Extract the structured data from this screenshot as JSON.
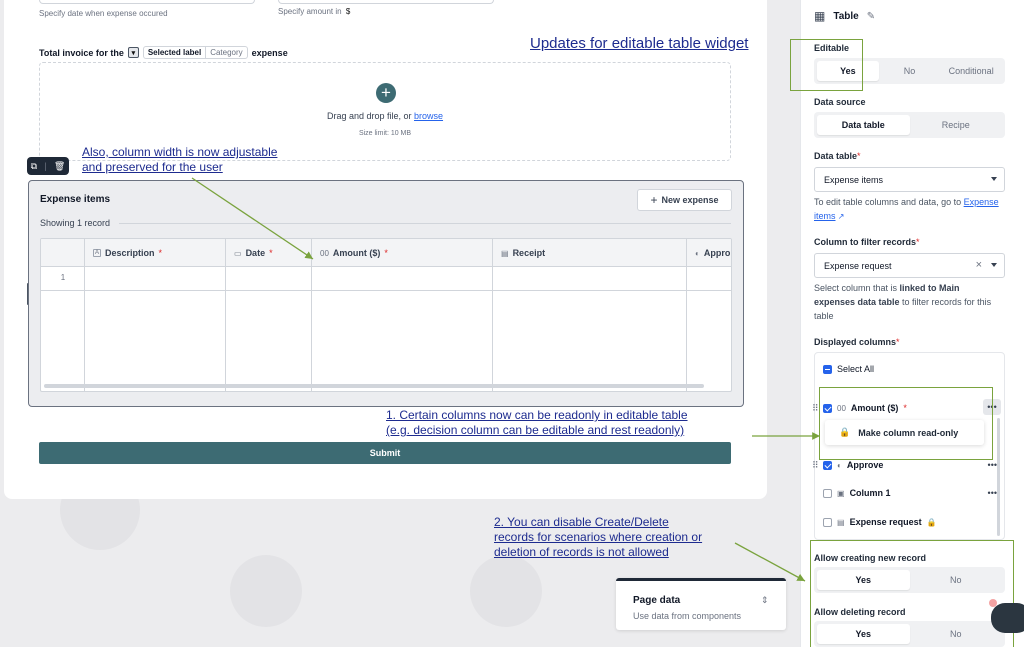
{
  "form": {
    "date_help": "Specify date when expense occured",
    "amount_help": "Specify amount in",
    "amount_currency": "$",
    "invoice_prefix": "Total invoice for the",
    "chip_selected": "Selected label",
    "chip_category": "Category",
    "invoice_suffix": "expense",
    "drop_text": "Drag and drop file, or ",
    "drop_link": "browse",
    "size_limit": "Size limit: 10 MB",
    "submit_label": "Submit"
  },
  "table_widget": {
    "title": "Expense items",
    "count_prefix": "Showing ",
    "count_value": "1",
    "count_suffix": " record",
    "new_button": "New expense",
    "columns": [
      {
        "label": "Description",
        "icon": "A",
        "required": "*"
      },
      {
        "label": "Date",
        "icon": "▭",
        "required": "*"
      },
      {
        "label": "Amount ($)",
        "icon": "00",
        "required": "*"
      },
      {
        "label": "Receipt",
        "icon": "▤",
        "required": ""
      },
      {
        "label": "Appro",
        "icon": "◐",
        "required": ""
      }
    ],
    "row_number": "1"
  },
  "annotations": {
    "title": "Updates for editable table widget",
    "width_line1": "Also, column width is now adjustable",
    "width_line2": "and preserved for the user",
    "readonly_line1": "1. Certain columns now can be readonly in editable table",
    "readonly_line2": "(e.g. decision column can be editable and rest readonly)",
    "disable_line1": "2. You can disable Create/Delete",
    "disable_line2": "records for scenarios where creation or",
    "disable_line3": "deletion of records is not allowed"
  },
  "page_data_card": {
    "title": "Page data",
    "subtitle": "Use data from components"
  },
  "panel": {
    "header": "Table",
    "editable_label": "Editable",
    "editable_options": [
      "Yes",
      "No",
      "Conditional"
    ],
    "datasource_label": "Data source",
    "datasource_options": [
      "Data table",
      "Recipe"
    ],
    "datatable_label": "Data table",
    "datatable_value": "Expense items",
    "datatable_help_prefix": "To edit table columns and data, go to ",
    "datatable_help_link1": "Expense",
    "datatable_help_link2": "items",
    "filter_label": "Column to filter records",
    "filter_value": "Expense request",
    "filter_help_prefix": "Select column that is ",
    "filter_help_bold1": "linked to Main",
    "filter_help_bold2": "expenses data table",
    "filter_help_suffix1": " to filter records for this",
    "filter_help_suffix2": "table",
    "displayed_label": "Displayed columns",
    "required_mark": "*",
    "select_all": "Select All",
    "col_amount": "Amount ($)",
    "col_amount_icon": "00",
    "make_readonly": "Make column read-only",
    "col_approve": "Approve",
    "col_column1": "Column 1",
    "col_expense_request": "Expense request",
    "allow_create_label": "Allow creating new record",
    "allow_create_options": [
      "Yes",
      "No"
    ],
    "allow_delete_label": "Allow deleting record",
    "allow_delete_options": [
      "Yes",
      "No"
    ]
  },
  "colors": {
    "accent": "#3d6b73",
    "annotation_text": "#1d2b8f",
    "highlight_green": "#7aa33e",
    "checkbox_blue": "#2563eb"
  }
}
